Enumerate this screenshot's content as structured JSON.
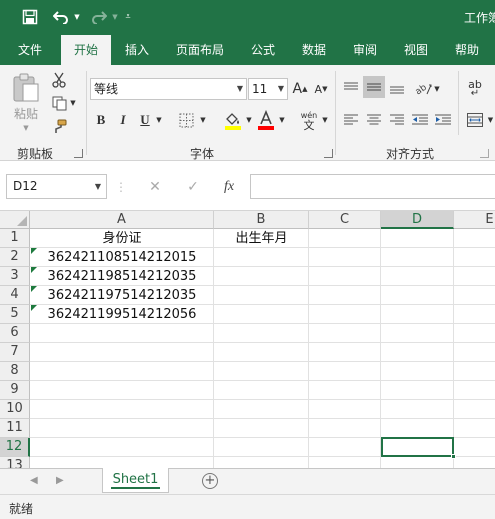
{
  "titlebar": {
    "title": "工作簿"
  },
  "tabs": [
    {
      "label": "文件"
    },
    {
      "label": "开始"
    },
    {
      "label": "插入"
    },
    {
      "label": "页面布局"
    },
    {
      "label": "公式"
    },
    {
      "label": "数据"
    },
    {
      "label": "审阅"
    },
    {
      "label": "视图"
    },
    {
      "label": "帮助"
    }
  ],
  "active_tab": "开始",
  "ribbon": {
    "clipboard": {
      "paste": "粘贴",
      "label": "剪贴板"
    },
    "font": {
      "name": "等线",
      "size": "11",
      "bold": "B",
      "italic": "I",
      "underline": "U",
      "grow": "A",
      "shrink": "A",
      "phonetic_top": "wén",
      "phonetic_bottom": "文",
      "label": "字体",
      "fill_color": "#ffff00",
      "font_color": "#ff0000"
    },
    "alignment": {
      "label": "对齐方式",
      "wrap": "ab"
    }
  },
  "formula_bar": {
    "name_box": "D12",
    "fx": "fx",
    "value": ""
  },
  "columns": [
    "A",
    "B",
    "C",
    "D",
    "E"
  ],
  "selected_column": "D",
  "rows": [
    "1",
    "2",
    "3",
    "4",
    "5",
    "6",
    "7",
    "8",
    "9",
    "10",
    "11",
    "12",
    "13"
  ],
  "selected_row": "12",
  "cells": {
    "A1": "身份证",
    "B1": "出生年月",
    "A2": "362421108514212015",
    "A3": "362421198514212035",
    "A4": "362421197514212035",
    "A5": "362421199514212056"
  },
  "sheets": [
    "Sheet1"
  ],
  "status": "就绪",
  "accent": "#217346"
}
